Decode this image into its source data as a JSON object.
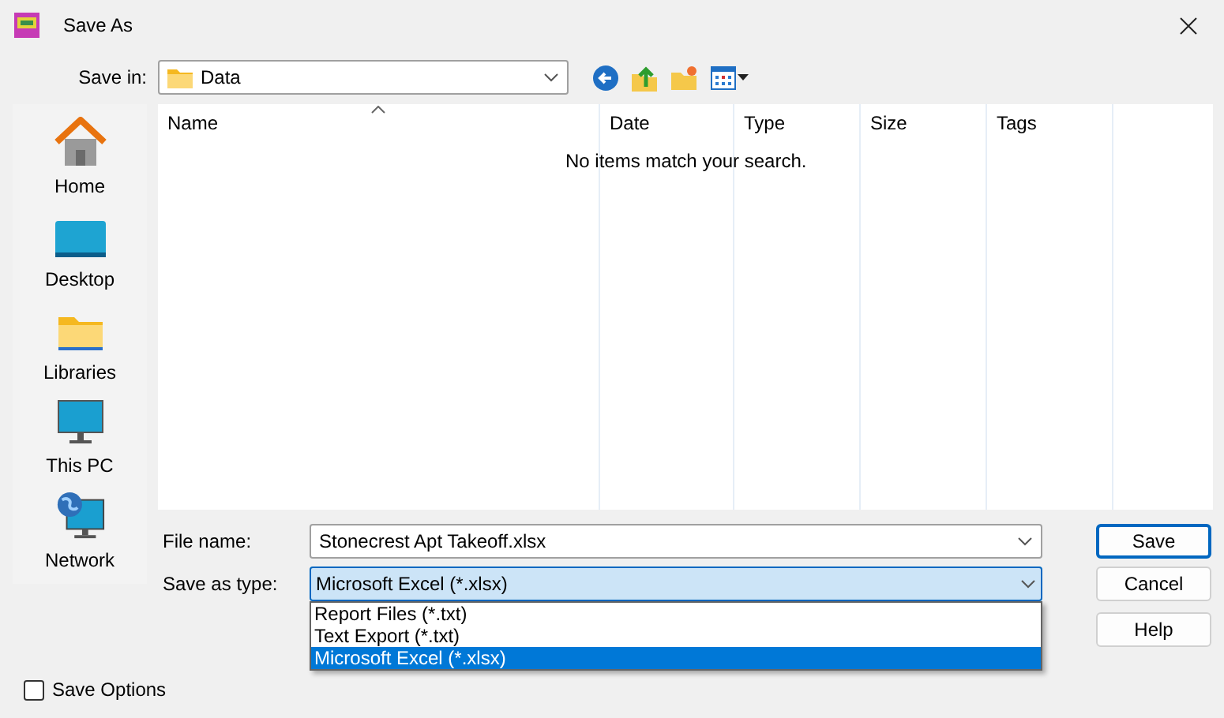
{
  "window": {
    "title": "Save As"
  },
  "save_in": {
    "label": "Save in:",
    "value": "Data"
  },
  "places": [
    {
      "label": "Home",
      "kind": "home"
    },
    {
      "label": "Desktop",
      "kind": "desktop"
    },
    {
      "label": "Libraries",
      "kind": "libraries"
    },
    {
      "label": "This PC",
      "kind": "pc"
    },
    {
      "label": "Network",
      "kind": "network"
    }
  ],
  "file_list": {
    "columns": [
      "Name",
      "Date",
      "Type",
      "Size",
      "Tags"
    ],
    "empty_message": "No items match your search."
  },
  "file_name": {
    "label": "File name:",
    "value": "Stonecrest Apt Takeoff.xlsx"
  },
  "save_as_type": {
    "label": "Save as type:",
    "value": "Microsoft Excel (*.xlsx)",
    "expanded": true,
    "options": [
      {
        "label": "Report Files (*.txt)",
        "selected": false
      },
      {
        "label": "Text Export (*.txt)",
        "selected": false
      },
      {
        "label": "Microsoft Excel (*.xlsx)",
        "selected": true
      }
    ]
  },
  "buttons": [
    {
      "label": "Save",
      "default": true
    },
    {
      "label": "Cancel",
      "default": false
    },
    {
      "label": "Help",
      "default": false
    }
  ],
  "save_options": {
    "label": "Save Options",
    "checked": false
  }
}
